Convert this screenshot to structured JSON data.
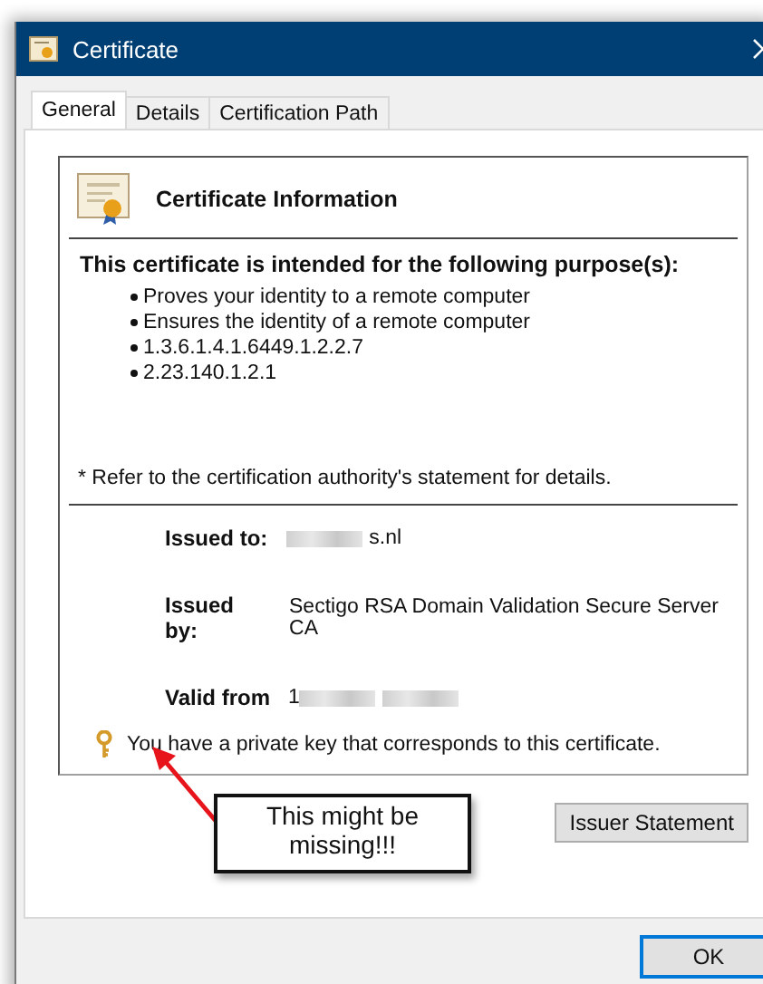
{
  "window": {
    "title": "Certificate"
  },
  "tabs": [
    {
      "label": "General",
      "selected": true
    },
    {
      "label": "Details",
      "selected": false
    },
    {
      "label": "Certification Path",
      "selected": false
    }
  ],
  "info": {
    "title": "Certificate Information",
    "purpose_heading": "This certificate is intended for the following purpose(s):",
    "purposes": [
      "Proves your identity to a remote computer",
      "Ensures the identity of a remote computer",
      "1.3.6.1.4.1.6449.1.2.2.7",
      "2.23.140.1.2.1"
    ],
    "footnote": "* Refer to the certification authority's statement for details."
  },
  "details": [
    {
      "label": "Issued to:",
      "segments": [
        {
          "kind": "redacted"
        },
        {
          "kind": "text",
          "text": "s.nl"
        }
      ]
    },
    {
      "label": "Issued by:",
      "segments": [
        {
          "kind": "text",
          "text": "Sectigo RSA Domain Validation Secure Server CA"
        }
      ]
    },
    {
      "label": "Valid from",
      "segments": [
        {
          "kind": "text",
          "text": "1"
        },
        {
          "kind": "redacted"
        },
        {
          "kind": "redacted"
        }
      ]
    }
  ],
  "private_key_note": "You have a private key that corresponds to this certificate.",
  "issuer_button": "Issuer Statement",
  "ok_button": "OK",
  "callout": "This might be missing!!!"
}
